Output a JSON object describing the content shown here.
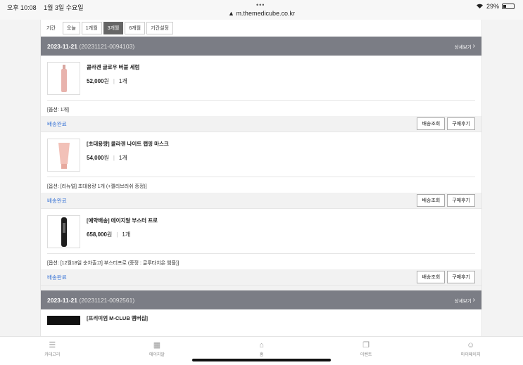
{
  "status_bar": {
    "time": "오후 10:08",
    "date": "1월 3일 수요일",
    "dots": "•••",
    "url": "m.themedicube.co.kr",
    "battery": "29%",
    "battery_level": 0.29
  },
  "filter": {
    "label": "기간",
    "buttons": [
      {
        "label": "오늘",
        "active": false
      },
      {
        "label": "1개월",
        "active": false
      },
      {
        "label": "3개월",
        "active": true
      },
      {
        "label": "6개월",
        "active": false
      },
      {
        "label": "기간설정",
        "active": false
      }
    ]
  },
  "orders": [
    {
      "date": "2023-11-21",
      "number": "(20231121-0094103)",
      "detail_label": "상세보기",
      "items": [
        {
          "name": "콜라겐 글로우 버블 세럼",
          "price": "52,000",
          "currency": "원",
          "qty": "1개",
          "option": "[옵션: 1개]",
          "status": "배송완료",
          "track_label": "배송조회",
          "review_label": "구매후기"
        },
        {
          "name": "[초대용량] 콜라겐 나이트 랩핑 마스크",
          "price": "54,000",
          "currency": "원",
          "qty": "1개",
          "option": "[옵션: [리뉴얼] 초대용량 1개 (+젤리브러쉬 증정)]",
          "status": "배송완료",
          "track_label": "배송조회",
          "review_label": "구매후기"
        },
        {
          "name": "[예약배송] 에이지알 부스터 프로",
          "price": "658,000",
          "currency": "원",
          "qty": "1개",
          "option": "[옵션: [12월18일 순차출고] 부스터프로 (증정 : 글루타치온 앰플)]",
          "status": "배송완료",
          "track_label": "배송조회",
          "review_label": "구매후기"
        }
      ]
    },
    {
      "date": "2023-11-21",
      "number": "(20231121-0092561)",
      "detail_label": "상세보기",
      "items": [
        {
          "name": "[프리미엄 M-CLUB 멤버십]"
        }
      ]
    }
  ],
  "bottom_nav": [
    {
      "label": "카테고리",
      "icon": "category-search-icon"
    },
    {
      "label": "에이지알",
      "icon": "device-icon"
    },
    {
      "label": "홈",
      "icon": "home-icon"
    },
    {
      "label": "이벤트",
      "icon": "event-icon"
    },
    {
      "label": "마이페이지",
      "icon": "user-icon"
    }
  ]
}
